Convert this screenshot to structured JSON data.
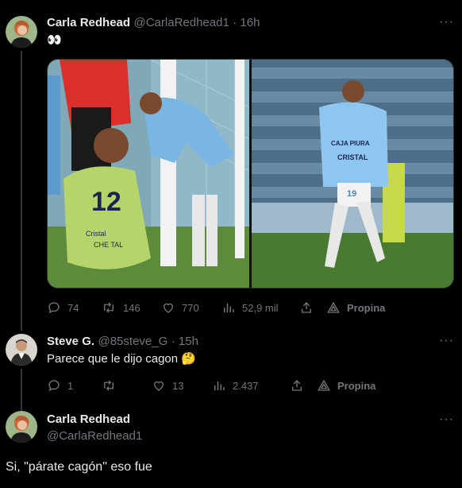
{
  "tweet1": {
    "name": "Carla Redhead",
    "handle": "@CarlaRedhead1",
    "time": "· 16h",
    "text": "👀",
    "actions": {
      "replies": "74",
      "reposts": "146",
      "likes": "770",
      "views": "52,9 mil",
      "promote": "Propina"
    },
    "photo_left": {
      "jersey_number": "12",
      "sponsor_lines": [
        "Cristal",
        "CHE TAL"
      ]
    },
    "photo_right": {
      "shirt_text": "CAJA PIURA",
      "sponsor": "CRISTAL",
      "shirt_number": "19"
    }
  },
  "tweet2": {
    "name": "Steve G.",
    "handle": "@85steve_G",
    "time": "· 15h",
    "text": "Parece que le dijo cagon 🤔",
    "actions": {
      "replies": "1",
      "reposts": "",
      "likes": "13",
      "views": "2.437",
      "promote": "Propina"
    }
  },
  "tweet3": {
    "name": "Carla Redhead",
    "handle": "@CarlaRedhead1",
    "text": "Si, \"párate cagón\" eso fue"
  },
  "more_icon": "···",
  "colors": {
    "background": "#000000",
    "text": "#e7e9ea",
    "muted": "#71767b",
    "border": "#2f3336"
  }
}
